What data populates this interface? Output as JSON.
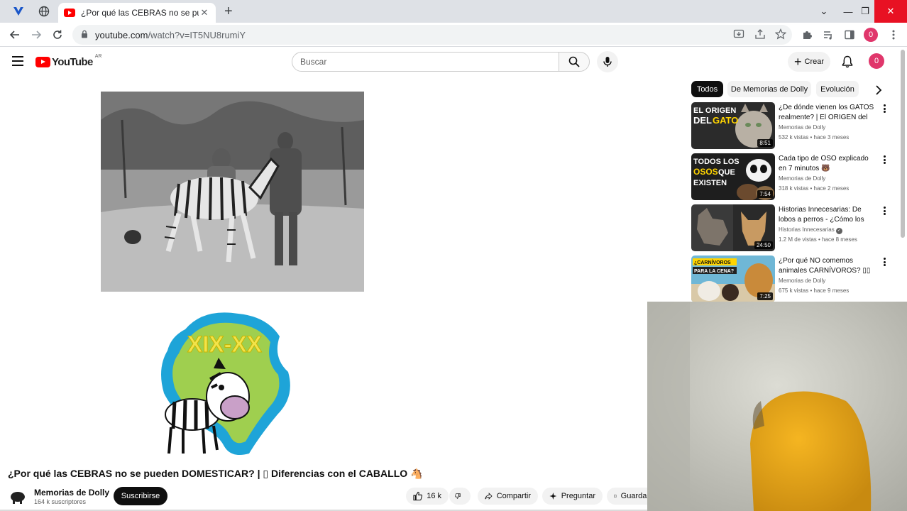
{
  "browser": {
    "tab_title": "¿Por qué las CEBRAS no se pueden",
    "tab_close": "✕",
    "new_tab": "+",
    "url_host": "youtube.com",
    "url_path": "/watch?v=IT5NU8rumiY",
    "profile_initial": "0",
    "window_controls": {
      "dropdown": "⌄",
      "minimize": "—",
      "restore": "❐",
      "close": "✕"
    }
  },
  "header": {
    "logo_text": "YouTube",
    "country_code": "AR",
    "search_placeholder": "Buscar",
    "create_label": "Crear",
    "create_plus": "+",
    "avatar_initial": "0"
  },
  "video": {
    "logo_text": "XIX-XX",
    "title": "¿Por qué las CEBRAS no se pueden DOMESTICAR? | ▯ Diferencias con el CABALLO 🐴",
    "channel_name": "Memorias de Dolly",
    "channel_subs": "164 k suscriptores",
    "subscribe_label": "Suscribirse",
    "likes": "16 k",
    "share_label": "Compartir",
    "ask_label": "Preguntar",
    "save_label": "Guardar"
  },
  "chips": [
    "Todos",
    "De Memorias de Dolly",
    "Evolución"
  ],
  "recommendations": [
    {
      "title": "¿De dónde vienen los GATOS realmente? | El ORIGEN del GATO",
      "channel": "Memorias de Dolly",
      "meta": "532 k vistas • hace 3 meses",
      "duration": "8:51",
      "thumb_text_1": "EL ORIGEN",
      "thumb_text_2": "DEL",
      "thumb_text_3": "GATO",
      "accent": "#ffd400"
    },
    {
      "title": "Cada tipo de OSO explicado en 7 minutos 🐻",
      "channel": "Memorias de Dolly",
      "meta": "318 k vistas • hace 2 meses",
      "duration": "7:54",
      "thumb_text_1": "TODOS LOS",
      "thumb_text_2": "OSOS",
      "thumb_text_3": "QUE",
      "thumb_text_4": "EXISTEN",
      "accent": "#ffd400"
    },
    {
      "title": "Historias Innecesarias: De lobos a perros - ¿Cómo los humanos crearon al perro?",
      "channel": "Historias Innecesarias",
      "meta": "1.2 M de vistas • hace 8 meses",
      "duration": "24:50",
      "verified": "✓"
    },
    {
      "title": "¿Por qué NO comemos animales CARNÍVOROS? ▯▯",
      "channel": "Memorias de Dolly",
      "meta": "675 k vistas • hace 9 meses",
      "duration": "7:25",
      "thumb_text_1": "¿CARNÍVOROS",
      "thumb_text_2": "PARA LA CENA?",
      "accent": "#ffd400"
    }
  ]
}
